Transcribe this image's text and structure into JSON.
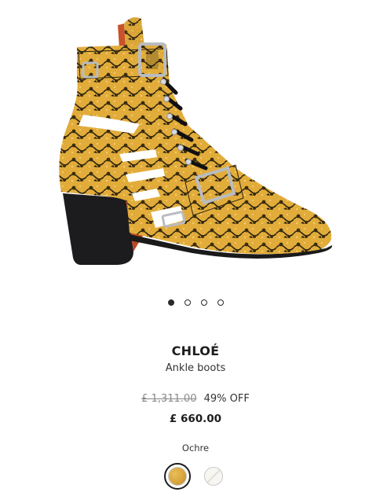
{
  "product": {
    "brand": "CHLOÉ",
    "name": "Ankle boots",
    "original_price": "£ 1,311.00",
    "discount": "49% OFF",
    "price": "£ 660.00",
    "color_name": "Ochre"
  },
  "gallery": {
    "image_icon": "snakeskin-ankle-boot-image",
    "total_images": 4,
    "active_image": 1
  },
  "swatches": [
    {
      "name": "Ochre",
      "color": "#d9a63c",
      "selected": true
    },
    {
      "name": "White",
      "color": "#efede5",
      "selected": false
    }
  ],
  "colors": {
    "text": "#1d1d1d",
    "muted_text": "#888888",
    "accent": "#2a2a2a"
  }
}
